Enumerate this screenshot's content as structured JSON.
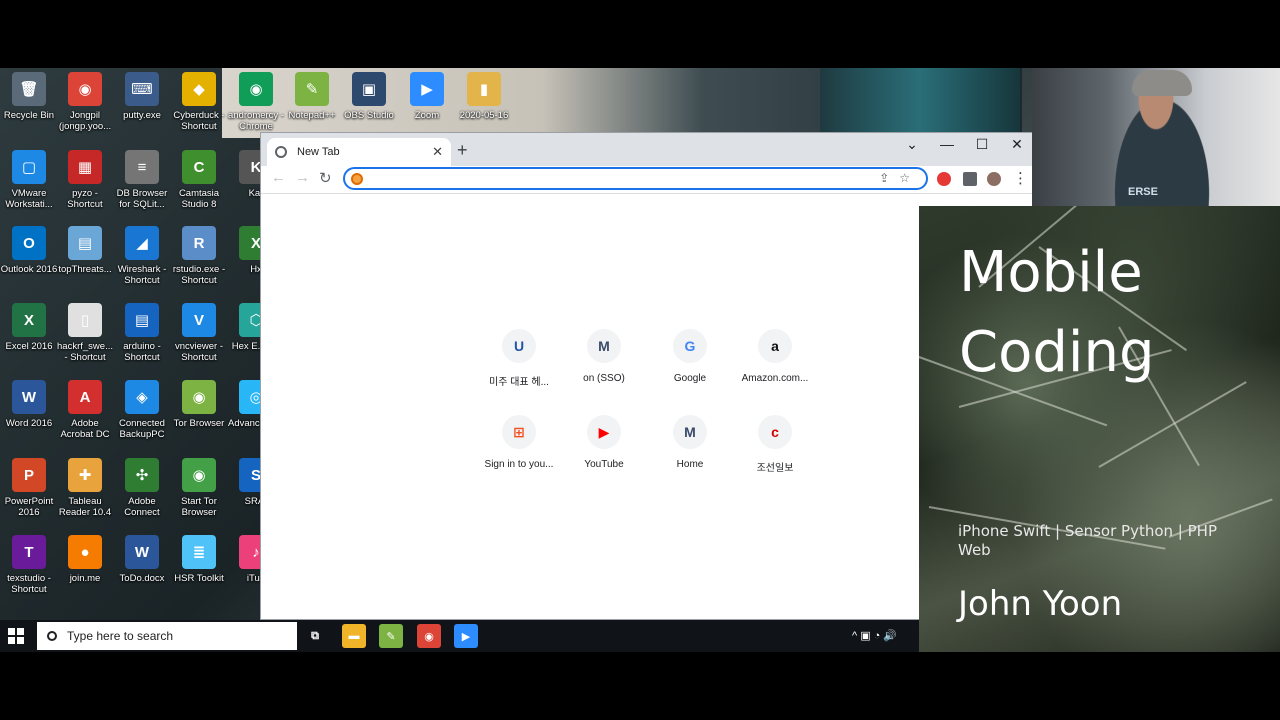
{
  "desktop": {
    "icons": [
      {
        "label": "Recycle Bin",
        "glyph": "🗑",
        "color": "#5a6a78"
      },
      {
        "label": "Jongpil (jongp.yoo...",
        "glyph": "◉",
        "color": "#db4437"
      },
      {
        "label": "putty.exe",
        "glyph": "⌨",
        "color": "#3b5b8a"
      },
      {
        "label": "Cyberduck - Shortcut",
        "glyph": "◆",
        "color": "#e5b100"
      },
      {
        "label": "andromercy - Chrome",
        "glyph": "◉",
        "color": "#0f9d58"
      },
      {
        "label": "Notepad++",
        "glyph": "✎",
        "color": "#7cb342"
      },
      {
        "label": "OBS Studio",
        "glyph": "▣",
        "color": "#2d4a6e"
      },
      {
        "label": "Zoom",
        "glyph": "▶",
        "color": "#2d8cff"
      },
      {
        "label": "2020-05-16",
        "glyph": "▮",
        "color": "#e2b44a"
      },
      {
        "label": "VMware Workstati...",
        "glyph": "▢",
        "color": "#1e88e5"
      },
      {
        "label": "pyzo - Shortcut",
        "glyph": "▦",
        "color": "#c62828"
      },
      {
        "label": "DB Browser for SQLit...",
        "glyph": "≡",
        "color": "#757575"
      },
      {
        "label": "Camtasia Studio 8",
        "glyph": "C",
        "color": "#3f8f2f"
      },
      {
        "label": "Kar",
        "glyph": "K",
        "color": "#555"
      },
      {
        "label": "Outlook 2016",
        "glyph": "O",
        "color": "#0072c6"
      },
      {
        "label": "topThreats...",
        "glyph": "▤",
        "color": "#6aa6d6"
      },
      {
        "label": "Wireshark - Shortcut",
        "glyph": "◢",
        "color": "#1976d2"
      },
      {
        "label": "rstudio.exe - Shortcut",
        "glyph": "R",
        "color": "#5b8ec9"
      },
      {
        "label": "Hx",
        "glyph": "X",
        "color": "#2e7d32"
      },
      {
        "label": "Excel 2016",
        "glyph": "X",
        "color": "#217346"
      },
      {
        "label": "hackrf_swe... - Shortcut",
        "glyph": "▯",
        "color": "#e0e0e0"
      },
      {
        "label": "arduino - Shortcut",
        "glyph": "▤",
        "color": "#1565c0"
      },
      {
        "label": "vncviewer - Shortcut",
        "glyph": "V",
        "color": "#1e88e5"
      },
      {
        "label": "Hex E... Ne",
        "glyph": "⬡",
        "color": "#26a69a"
      },
      {
        "label": "Word 2016",
        "glyph": "W",
        "color": "#2b579a"
      },
      {
        "label": "Adobe Acrobat DC",
        "glyph": "A",
        "color": "#d32f2f"
      },
      {
        "label": "Connected BackupPC",
        "glyph": "◈",
        "color": "#1e88e5"
      },
      {
        "label": "Tor Browser",
        "glyph": "◉",
        "color": "#7cb342"
      },
      {
        "label": "Advanc Scan",
        "glyph": "◎",
        "color": "#29b6f6"
      },
      {
        "label": "PowerPoint 2016",
        "glyph": "P",
        "color": "#d24726"
      },
      {
        "label": "Tableau Reader 10.4",
        "glyph": "✚",
        "color": "#e8a33d"
      },
      {
        "label": "Adobe Connect",
        "glyph": "✣",
        "color": "#2e7d32"
      },
      {
        "label": "Start Tor Browser",
        "glyph": "◉",
        "color": "#43a047"
      },
      {
        "label": "SRA-",
        "glyph": "S",
        "color": "#1565c0"
      },
      {
        "label": "texstudio - Shortcut",
        "glyph": "T",
        "color": "#6a1b9a"
      },
      {
        "label": "join.me",
        "glyph": "●",
        "color": "#f57c00"
      },
      {
        "label": "ToDo.docx",
        "glyph": "W",
        "color": "#2b579a"
      },
      {
        "label": "HSR Toolkit",
        "glyph": "≣",
        "color": "#4fc3f7"
      },
      {
        "label": "iTun",
        "glyph": "♪",
        "color": "#ec407a"
      }
    ]
  },
  "chrome": {
    "tab_title": "New Tab",
    "tab_close": "✕",
    "new_tab": "+",
    "window": {
      "dropdown": "⌄",
      "minimize": "—",
      "maximize": "☐",
      "close": "✕"
    },
    "nav": {
      "back": "←",
      "forward": "→",
      "reload": "↻"
    },
    "omnibox": {
      "value": "",
      "placeholder": "",
      "icons": "⇪☆"
    },
    "extensions": [
      {
        "name": "adblock",
        "color": "#e53935"
      },
      {
        "name": "extensions",
        "color": "#5f6368"
      },
      {
        "name": "profile",
        "color": "#8d6e63"
      }
    ],
    "menu": "⋮",
    "shortcuts": [
      {
        "label": "미주 대표 헤...",
        "glyph": "U",
        "color": "#2456a6"
      },
      {
        "label": "on (SSO)",
        "glyph": "M",
        "color": "#3a4a6b"
      },
      {
        "label": "Google",
        "glyph": "G",
        "color": "#4285f4"
      },
      {
        "label": "Amazon.com...",
        "glyph": "a",
        "color": "#111111"
      },
      {
        "label": "Sign in to you...",
        "glyph": "⊞",
        "color": "#f25022"
      },
      {
        "label": "YouTube",
        "glyph": "▶",
        "color": "#ff0000"
      },
      {
        "label": "Home",
        "glyph": "M",
        "color": "#3a4a6b"
      },
      {
        "label": "조선일보",
        "glyph": "c",
        "color": "#d50000"
      }
    ]
  },
  "webcam": {
    "shirt_text": "ERSE"
  },
  "title_card": {
    "line1": "Mobile",
    "line2": "Coding",
    "subtitle": "iPhone Swift | Sensor Python | PHP Web",
    "author": "John Yoon"
  },
  "taskbar": {
    "search_placeholder": "Type here to search",
    "apps": [
      {
        "name": "task-view",
        "glyph": "⧉",
        "color": "#101418"
      },
      {
        "name": "file-explorer",
        "glyph": "▬",
        "color": "#f0b429"
      },
      {
        "name": "notepad-plus-plus",
        "glyph": "✎",
        "color": "#7cb342"
      },
      {
        "name": "chrome",
        "glyph": "◉",
        "color": "#db4437"
      },
      {
        "name": "zoom",
        "glyph": "▶",
        "color": "#2d8cff"
      }
    ],
    "tray": "^ ▣ ◔ 🔊"
  }
}
